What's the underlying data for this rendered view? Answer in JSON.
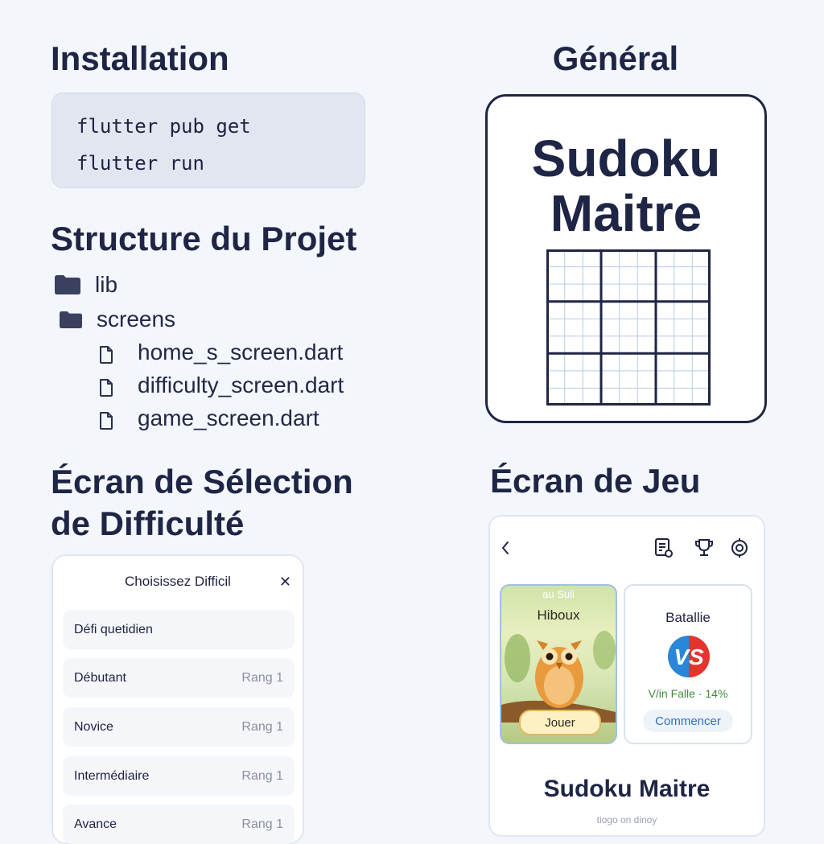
{
  "installation": {
    "title": "Installation",
    "commands": [
      "flutter pub get",
      "flutter run"
    ]
  },
  "structure": {
    "title": "Structure du Projet",
    "folders": [
      "lib",
      "screens"
    ],
    "files": [
      "home_s_screen.dart",
      "difficulty_screen.dart",
      "game_screen.dart"
    ]
  },
  "general": {
    "title": "Général",
    "app_name_line1": "Sudoku",
    "app_name_line2": "Maitre"
  },
  "difficulty": {
    "title_line1": "Écran de Sélection",
    "title_line2": "de Difficulté",
    "header": "Choisissez Difficil",
    "items": [
      {
        "label": "Défi quetidien",
        "rank": ""
      },
      {
        "label": "Débutant",
        "rank": "Rang 1"
      },
      {
        "label": "Novice",
        "rank": "Rang 1"
      },
      {
        "label": "Intermédiaire",
        "rank": "Rang 1"
      },
      {
        "label": "Avance",
        "rank": "Rang 1"
      }
    ]
  },
  "game": {
    "title": "Écran de Jeu",
    "toolbar_icons": [
      "back-icon",
      "notes-icon",
      "trophy-icon",
      "settings-icon"
    ],
    "owl_card": {
      "subtitle": "au Suli",
      "name": "Hiboux",
      "play_label": "Jouer"
    },
    "battle_card": {
      "name": "Batallie",
      "stat": "V/in Falle · 14%",
      "start_label": "Commencer"
    },
    "app_title": "Sudoku Maitre",
    "app_subtitle": "tiogo on dinoy"
  },
  "colors": {
    "background": "#f3f6fb",
    "text_dark": "#1f2545",
    "code_bg": "#e1e6f1",
    "accent_blue": "#2f6fb8",
    "accent_green": "#3f8a3a",
    "vs_red": "#e3342f",
    "vs_blue": "#2a86d6"
  }
}
